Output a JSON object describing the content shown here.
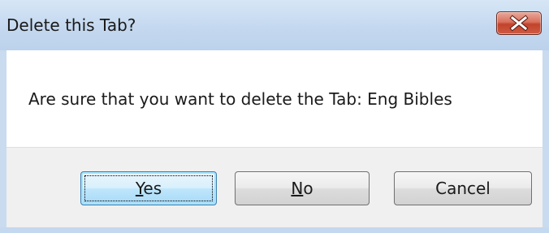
{
  "dialog": {
    "title": "Delete this Tab?",
    "close_icon": "close-icon",
    "message": "Are sure that you want to delete the Tab: Eng Bibles"
  },
  "buttons": {
    "yes": {
      "mnemonic": "Y",
      "rest": "es",
      "label": "Yes",
      "is_default": true
    },
    "no": {
      "mnemonic": "N",
      "rest": "o",
      "label": "No"
    },
    "cancel": {
      "label": "Cancel"
    }
  },
  "colors": {
    "title_bar": "#c4d8ef",
    "close_button": "#c2432c",
    "footer": "#f0f0f0",
    "default_button_border": "#3c7fb1"
  }
}
